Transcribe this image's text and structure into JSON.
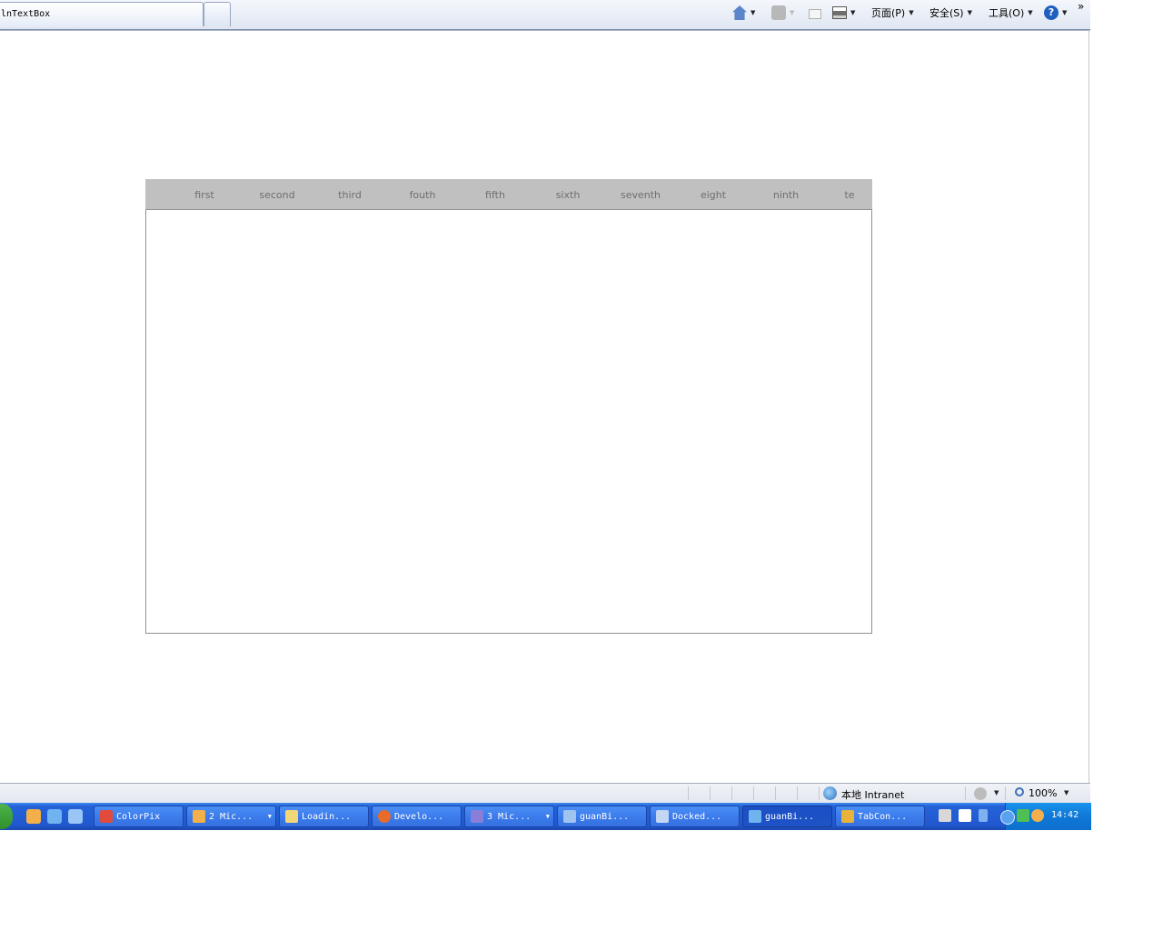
{
  "browser": {
    "tab_title": "lnTextBox",
    "commands": {
      "page": "页面(P)",
      "safety": "安全(S)",
      "tools": "工具(O)"
    },
    "more": "»"
  },
  "tab_control": {
    "tabs": [
      "first",
      "second",
      "third",
      "fouth",
      "fifth",
      "sixth",
      "seventh",
      "eight",
      "ninth",
      "te"
    ]
  },
  "status_bar": {
    "zone": "本地 Intranet",
    "zoom": "100%"
  },
  "taskbar": {
    "tasks": [
      "ColorPix",
      "2 Mic...",
      "Loadin...",
      "Develo...",
      "3 Mic...",
      "guanBi...",
      "Docked...",
      "guanBi...",
      "TabCon..."
    ],
    "clock": "14:42"
  },
  "colors": {
    "tab_strip_bg": "#c0c0c0",
    "tab_label": "#6e6e6e",
    "taskbar": "#2158d0"
  }
}
